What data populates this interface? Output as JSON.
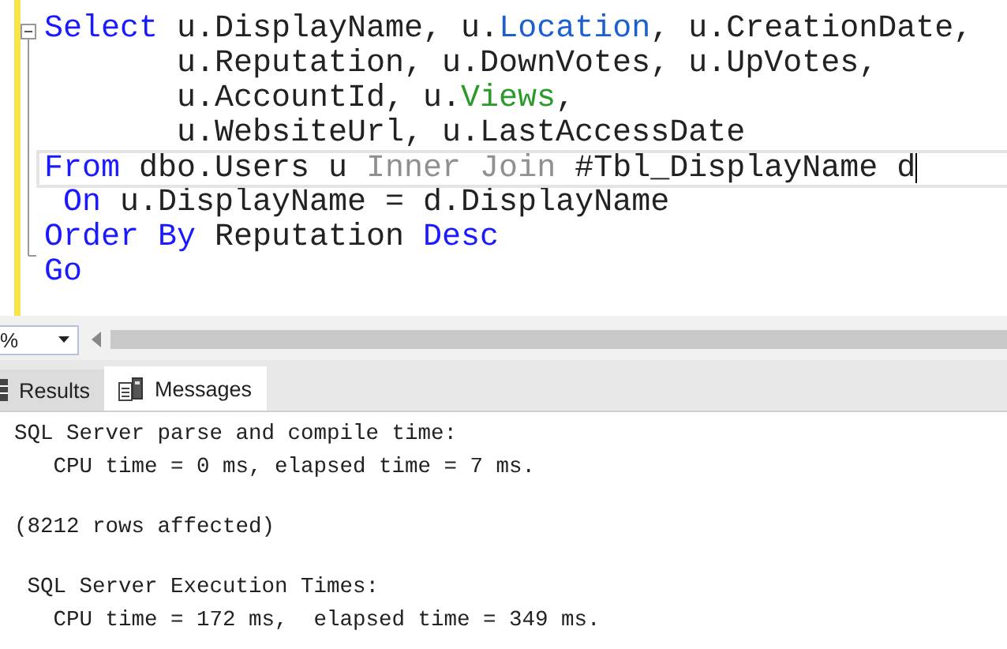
{
  "editor": {
    "lines": [
      {
        "current": false,
        "tokens": [
          {
            "text": "Select",
            "kind": "keyword"
          },
          {
            "text": " u.DisplayName, u.",
            "kind": "plain"
          },
          {
            "text": "Location",
            "kind": "system"
          },
          {
            "text": ", u.CreationDate,",
            "kind": "plain"
          }
        ]
      },
      {
        "current": false,
        "tokens": [
          {
            "text": "       u.Reputation, u.DownVotes, u.UpVotes,",
            "kind": "plain"
          }
        ]
      },
      {
        "current": false,
        "tokens": [
          {
            "text": "       u.AccountId, u.",
            "kind": "plain"
          },
          {
            "text": "Views",
            "kind": "function"
          },
          {
            "text": ",",
            "kind": "plain"
          }
        ]
      },
      {
        "current": false,
        "tokens": [
          {
            "text": "       u.WebsiteUrl, u.LastAccessDate",
            "kind": "plain"
          }
        ]
      },
      {
        "current": true,
        "tokens": [
          {
            "text": "From",
            "kind": "keyword"
          },
          {
            "text": " dbo.Users u ",
            "kind": "plain"
          },
          {
            "text": "Inner Join",
            "kind": "operator"
          },
          {
            "text": " #Tbl_DisplayName d",
            "kind": "plain"
          }
        ]
      },
      {
        "current": false,
        "tokens": [
          {
            "text": " On",
            "kind": "keyword"
          },
          {
            "text": " u.DisplayName = d.DisplayName",
            "kind": "plain"
          }
        ]
      },
      {
        "current": false,
        "tokens": [
          {
            "text": "Order By",
            "kind": "keyword"
          },
          {
            "text": " Reputation ",
            "kind": "plain"
          },
          {
            "text": "Desc",
            "kind": "keyword"
          }
        ]
      },
      {
        "current": false,
        "tokens": [
          {
            "text": "Go",
            "kind": "keyword"
          }
        ]
      }
    ]
  },
  "zoom": {
    "value": "%"
  },
  "tabs": [
    {
      "label": "Results",
      "selected": false
    },
    {
      "label": "Messages",
      "selected": true
    }
  ],
  "messages": [
    [
      "SQL Server parse and compile time:",
      "   CPU time = 0 ms, elapsed time = 7 ms."
    ],
    [
      "(8212 rows affected)"
    ],
    [
      " SQL Server Execution Times:",
      "   CPU time = 172 ms,  elapsed time = 349 ms."
    ]
  ]
}
